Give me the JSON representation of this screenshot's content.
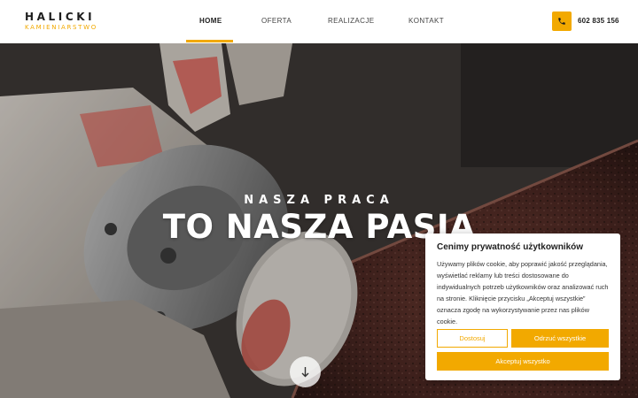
{
  "logo": {
    "name": "HALICKI",
    "subtitle": "KAMIENIARSTWO"
  },
  "nav": {
    "items": [
      {
        "label": "HOME",
        "active": true
      },
      {
        "label": "OFERTA",
        "active": false
      },
      {
        "label": "REALIZACJE",
        "active": false
      },
      {
        "label": "KONTAKT",
        "active": false
      }
    ]
  },
  "contact": {
    "phone": "602 835 156",
    "icon": "phone-icon"
  },
  "hero": {
    "kicker": "NASZA PRACA",
    "headline": "TO NASZA PASJA",
    "scroll_icon": "arrow-down-icon"
  },
  "cookie": {
    "title": "Cenimy prywatność użytkowników",
    "text": "Używamy plików cookie, aby poprawić jakość przeglądania, wyświetlać reklamy lub treści dostosowane do indywidualnych potrzeb użytkowników oraz analizować ruch na stronie. Kliknięcie przycisku „Akceptuj wszystkie” oznacza zgodę na wykorzystywanie przez nas plików cookie.",
    "customize_label": "Dostosuj",
    "reject_label": "Odrzuć wszystkie",
    "accept_label": "Akceptuj wszystko"
  },
  "colors": {
    "accent": "#f2a900",
    "text_dark": "#1d1d1d"
  }
}
